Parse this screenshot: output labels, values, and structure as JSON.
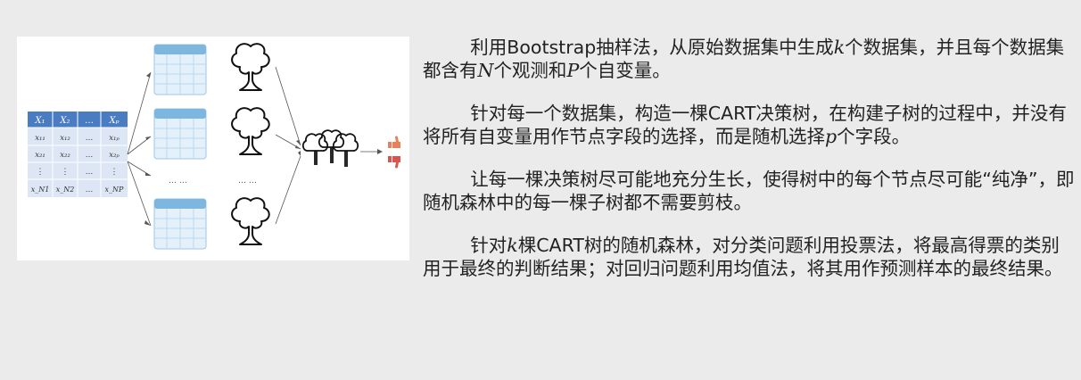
{
  "diagram": {
    "input_table": {
      "header": [
        "X₁",
        "X₂",
        "…",
        "Xₚ"
      ],
      "rows": [
        [
          "x₁₁",
          "x₁₂",
          "…",
          "x₁ₚ"
        ],
        [
          "x₂₁",
          "x₂₂",
          "…",
          "x₂ₚ"
        ],
        [
          "⋮",
          "⋮",
          "…",
          "⋮"
        ],
        [
          "x_N1",
          "x_N2",
          "…",
          "x_NP"
        ]
      ],
      "header_color": "#4a7cc2",
      "row_color": "#dce6f4"
    },
    "ellipsis_tables": "… …",
    "ellipsis_trees": "… …",
    "vote_icons": [
      "thumbs-up-icon",
      "thumbs-down-icon"
    ],
    "colors": {
      "table_header": "#7db7e0",
      "table_cell": "#e5f1fa",
      "thumb_up": "#e8805a",
      "thumb_down": "#d9534f"
    }
  },
  "paragraphs": [
    {
      "before": "利用Bootstrap抽样法，从原始数据集中生成",
      "var": "k",
      "after": "个数据集，并且每个数据集都含有",
      "var2": "N",
      "after2": "个观测和",
      "var3": "P",
      "after3": "个自变量。"
    },
    {
      "before": "针对每一个数据集，构造一棵CART决策树，在构建子树的过程中，并没有将所有自变量用作节点字段的选择，而是随机选择",
      "var": "p",
      "after": "个字段。"
    },
    {
      "text": "让每一棵决策树尽可能地充分生长，使得树中的每个节点尽可能“纯净”，即随机森林中的每一棵子树都不需要剪枝。"
    },
    {
      "before": "针对",
      "var": "k",
      "after": "棵CART树的随机森林，对分类问题利用投票法，将最高得票的类别用于最终的判断结果；对回归问题利用均值法，将其用作预测样本的最终结果。"
    }
  ]
}
